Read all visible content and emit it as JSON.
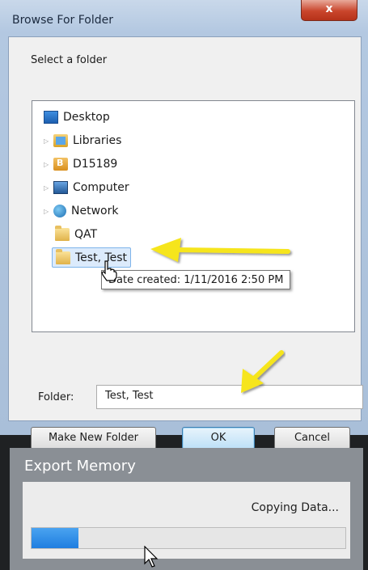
{
  "browse_dialog": {
    "title": "Browse For Folder",
    "close_glyph": "x",
    "prompt": "Select a folder",
    "tree": [
      {
        "label": "Desktop",
        "icon": "desktop-icon"
      },
      {
        "label": "Libraries",
        "icon": "libraries-icon",
        "expandable": true
      },
      {
        "label": "D15189",
        "icon": "user-folder-icon",
        "expandable": true
      },
      {
        "label": "Computer",
        "icon": "computer-icon",
        "expandable": true
      },
      {
        "label": "Network",
        "icon": "network-icon",
        "expandable": true
      },
      {
        "label": "QAT",
        "icon": "folder-icon"
      },
      {
        "label": "Test, Test",
        "icon": "folder-icon",
        "selected": true
      }
    ],
    "tooltip": "Date created: 1/11/2016 2:50 PM",
    "folder_label": "Folder:",
    "folder_value": "Test, Test",
    "buttons": {
      "make_new_folder": "Make New Folder",
      "ok": "OK",
      "cancel": "Cancel"
    }
  },
  "export_dialog": {
    "title": "Export Memory",
    "status": "Copying Data...",
    "progress_fraction": 0.15
  },
  "colors": {
    "annotation_arrow": "#f6e51c",
    "progress": "#2c89e8"
  }
}
